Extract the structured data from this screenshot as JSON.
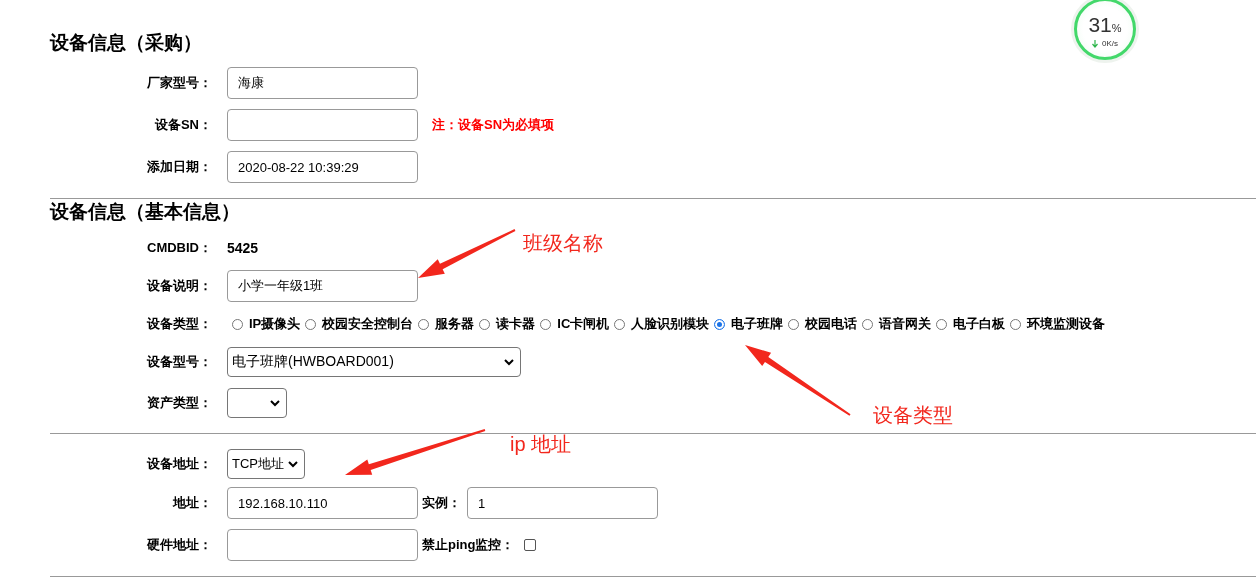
{
  "speed_widget": {
    "percent": "31",
    "unit": "%",
    "rate": "0K/s"
  },
  "purchase": {
    "title": "设备信息（采购）",
    "fields": [
      {
        "label": "厂家型号：",
        "value": "海康"
      },
      {
        "label": "设备SN：",
        "note": "注：设备SN为必填项"
      },
      {
        "label": "添加日期：",
        "value": "2020-08-22 10:39:29"
      }
    ]
  },
  "basic": {
    "title": "设备信息（基本信息）",
    "cmdb": {
      "label": "CMDBID：",
      "value": "5425"
    },
    "description": {
      "label": "设备说明：",
      "value": "小学一年级1班"
    },
    "device_type": {
      "label": "设备类型：",
      "options": [
        {
          "label": "IP摄像头",
          "selected": false
        },
        {
          "label": "校园安全控制台",
          "selected": false
        },
        {
          "label": "服务器",
          "selected": false
        },
        {
          "label": "读卡器",
          "selected": false
        },
        {
          "label": "IC卡闸机",
          "selected": false
        },
        {
          "label": "人脸识别模块",
          "selected": false
        },
        {
          "label": "电子班牌",
          "selected": true
        },
        {
          "label": "校园电话",
          "selected": false
        },
        {
          "label": "语音网关",
          "selected": false
        },
        {
          "label": "电子白板",
          "selected": false
        },
        {
          "label": "环境监测设备",
          "selected": false
        }
      ]
    },
    "model": {
      "label": "设备型号：",
      "value": "电子班牌(HWBOARD001)"
    },
    "asset_type": {
      "label": "资产类型："
    }
  },
  "address": {
    "address_type": {
      "label": "设备地址：",
      "value": "TCP地址"
    },
    "address": {
      "label": "地址：",
      "value": "192.168.10.110"
    },
    "instance": {
      "label": "实例：",
      "value": "1"
    },
    "hardware": {
      "label": "硬件地址："
    },
    "no_ping": {
      "label": "禁止ping监控：",
      "checked": false
    }
  },
  "annotations": [
    {
      "text": "班级名称"
    },
    {
      "text": "设备类型"
    },
    {
      "text": "ip 地址"
    }
  ]
}
